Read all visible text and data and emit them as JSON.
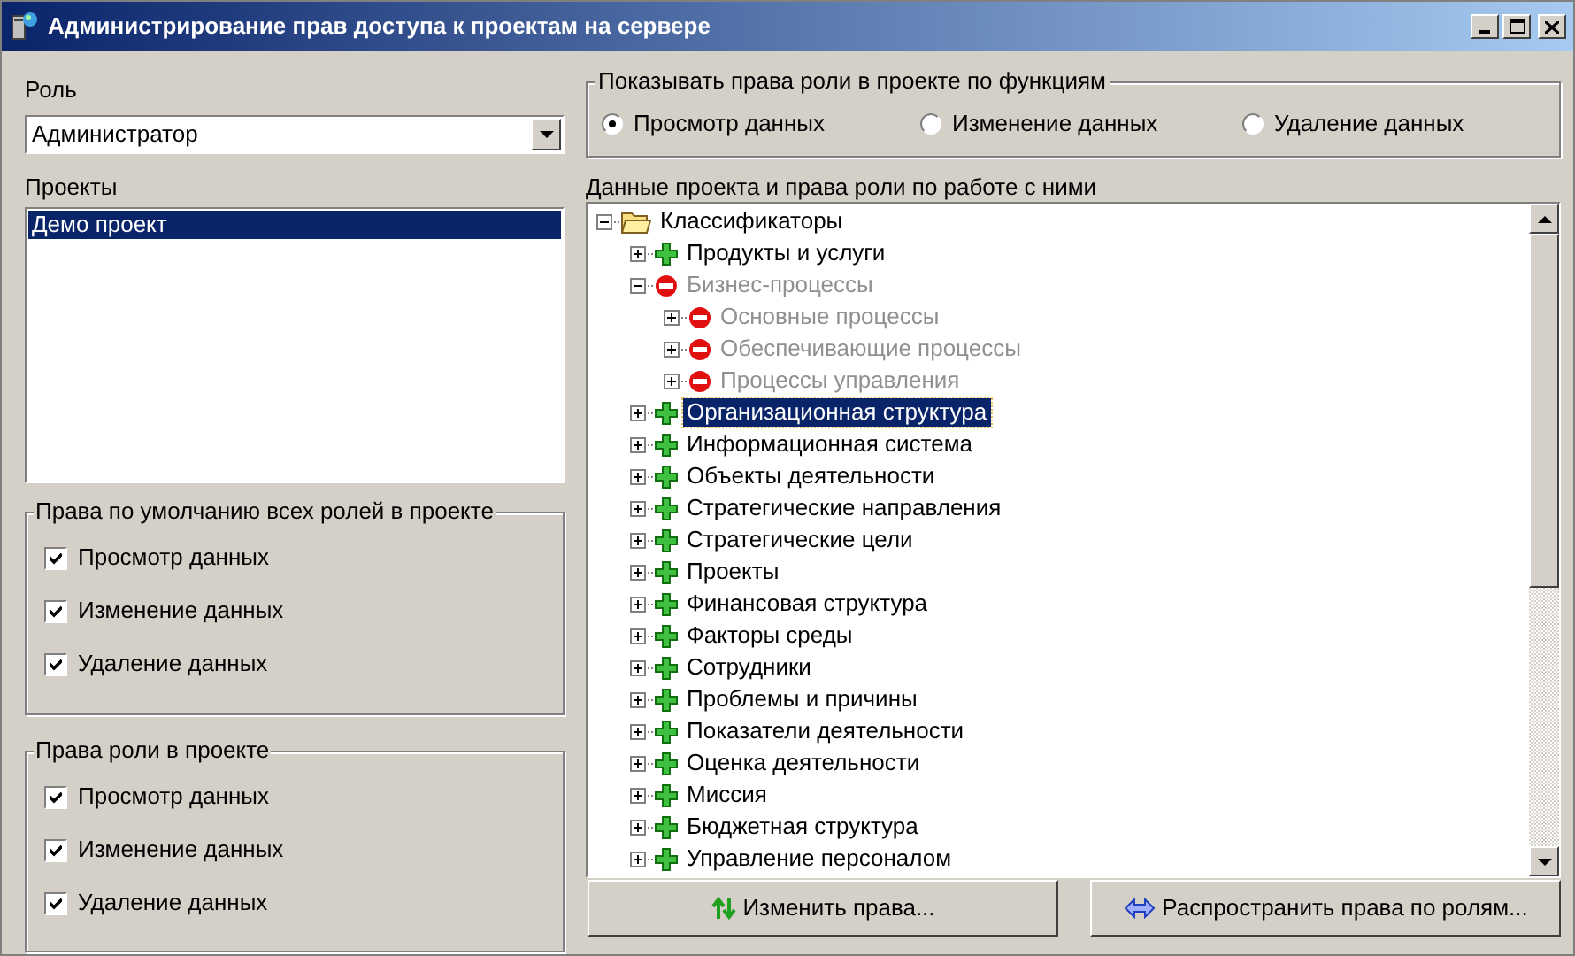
{
  "window": {
    "title": "Администрирование прав доступа к проектам на сервере"
  },
  "role": {
    "label": "Роль",
    "value": "Администратор"
  },
  "projects": {
    "label": "Проекты",
    "items": [
      {
        "label": "Демо проект",
        "selected": true
      }
    ]
  },
  "default_rights": {
    "title": "Права по умолчанию всех ролей в проекте",
    "items": [
      {
        "label": "Просмотр данных",
        "checked": true
      },
      {
        "label": "Изменение данных",
        "checked": true
      },
      {
        "label": "Удаление данных",
        "checked": true
      }
    ]
  },
  "role_rights": {
    "title": "Права роли в проекте",
    "items": [
      {
        "label": "Просмотр данных",
        "checked": true
      },
      {
        "label": "Изменение данных",
        "checked": true
      },
      {
        "label": "Удаление данных",
        "checked": true
      }
    ]
  },
  "show_by_function": {
    "title": "Показывать права роли в проекте по функциям",
    "options": [
      {
        "label": "Просмотр данных",
        "selected": true
      },
      {
        "label": "Изменение данных",
        "selected": false
      },
      {
        "label": "Удаление данных",
        "selected": false
      }
    ]
  },
  "tree": {
    "label": "Данные проекта и права роли по работе с ними",
    "items": [
      {
        "label": "Классификаторы",
        "kind": "folder",
        "expanded": true,
        "selected": false,
        "children": [
          {
            "label": "Продукты и услуги",
            "kind": "allowed",
            "expanded": false,
            "selected": false
          },
          {
            "label": "Бизнес-процессы",
            "kind": "denied",
            "expanded": true,
            "selected": false,
            "children": [
              {
                "label": "Основные процессы",
                "kind": "denied",
                "expanded": false,
                "selected": false
              },
              {
                "label": "Обеспечивающие процессы",
                "kind": "denied",
                "expanded": false,
                "selected": false
              },
              {
                "label": "Процессы управления",
                "kind": "denied",
                "expanded": false,
                "selected": false
              }
            ]
          },
          {
            "label": "Организационная структура",
            "kind": "allowed",
            "expanded": false,
            "selected": true
          },
          {
            "label": "Информационная система",
            "kind": "allowed",
            "expanded": false,
            "selected": false
          },
          {
            "label": "Объекты деятельности",
            "kind": "allowed",
            "expanded": false,
            "selected": false
          },
          {
            "label": "Стратегические направления",
            "kind": "allowed",
            "expanded": false,
            "selected": false
          },
          {
            "label": "Стратегические цели",
            "kind": "allowed",
            "expanded": false,
            "selected": false
          },
          {
            "label": "Проекты",
            "kind": "allowed",
            "expanded": false,
            "selected": false
          },
          {
            "label": "Финансовая структура",
            "kind": "allowed",
            "expanded": false,
            "selected": false
          },
          {
            "label": "Факторы среды",
            "kind": "allowed",
            "expanded": false,
            "selected": false
          },
          {
            "label": "Сотрудники",
            "kind": "allowed",
            "expanded": false,
            "selected": false
          },
          {
            "label": "Проблемы и причины",
            "kind": "allowed",
            "expanded": false,
            "selected": false
          },
          {
            "label": "Показатели деятельности",
            "kind": "allowed",
            "expanded": false,
            "selected": false
          },
          {
            "label": "Оценка деятельности",
            "kind": "allowed",
            "expanded": false,
            "selected": false
          },
          {
            "label": "Миссия",
            "kind": "allowed",
            "expanded": false,
            "selected": false
          },
          {
            "label": "Бюджетная структура",
            "kind": "allowed",
            "expanded": false,
            "selected": false
          },
          {
            "label": "Управление персоналом",
            "kind": "allowed",
            "expanded": false,
            "selected": false
          }
        ]
      }
    ]
  },
  "buttons": [
    {
      "label": "Изменить права...",
      "kind": "updown"
    },
    {
      "label": "Распространить права по ролям...",
      "kind": "leftright"
    }
  ]
}
